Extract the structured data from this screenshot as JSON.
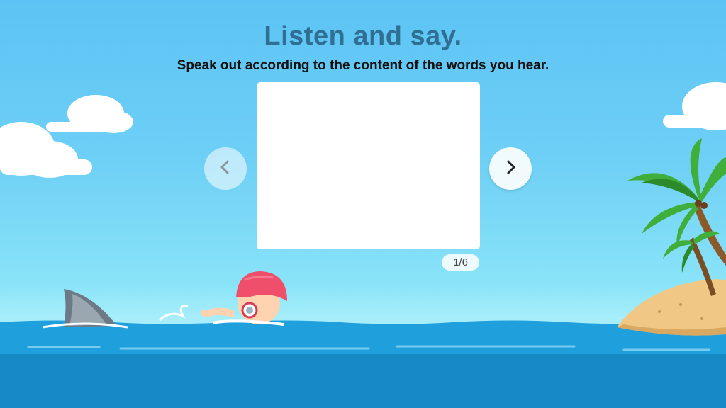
{
  "lesson": {
    "title": "Listen and say.",
    "instruction": "Speak out according to the content of the words you hear."
  },
  "pager": {
    "counter": "1/6",
    "prev_icon": "chevron-left-icon",
    "next_icon": "chevron-right-icon"
  },
  "colors": {
    "title": "#2f6f93",
    "sky_top": "#5cc3f4",
    "sea": "#1f9fdc"
  }
}
